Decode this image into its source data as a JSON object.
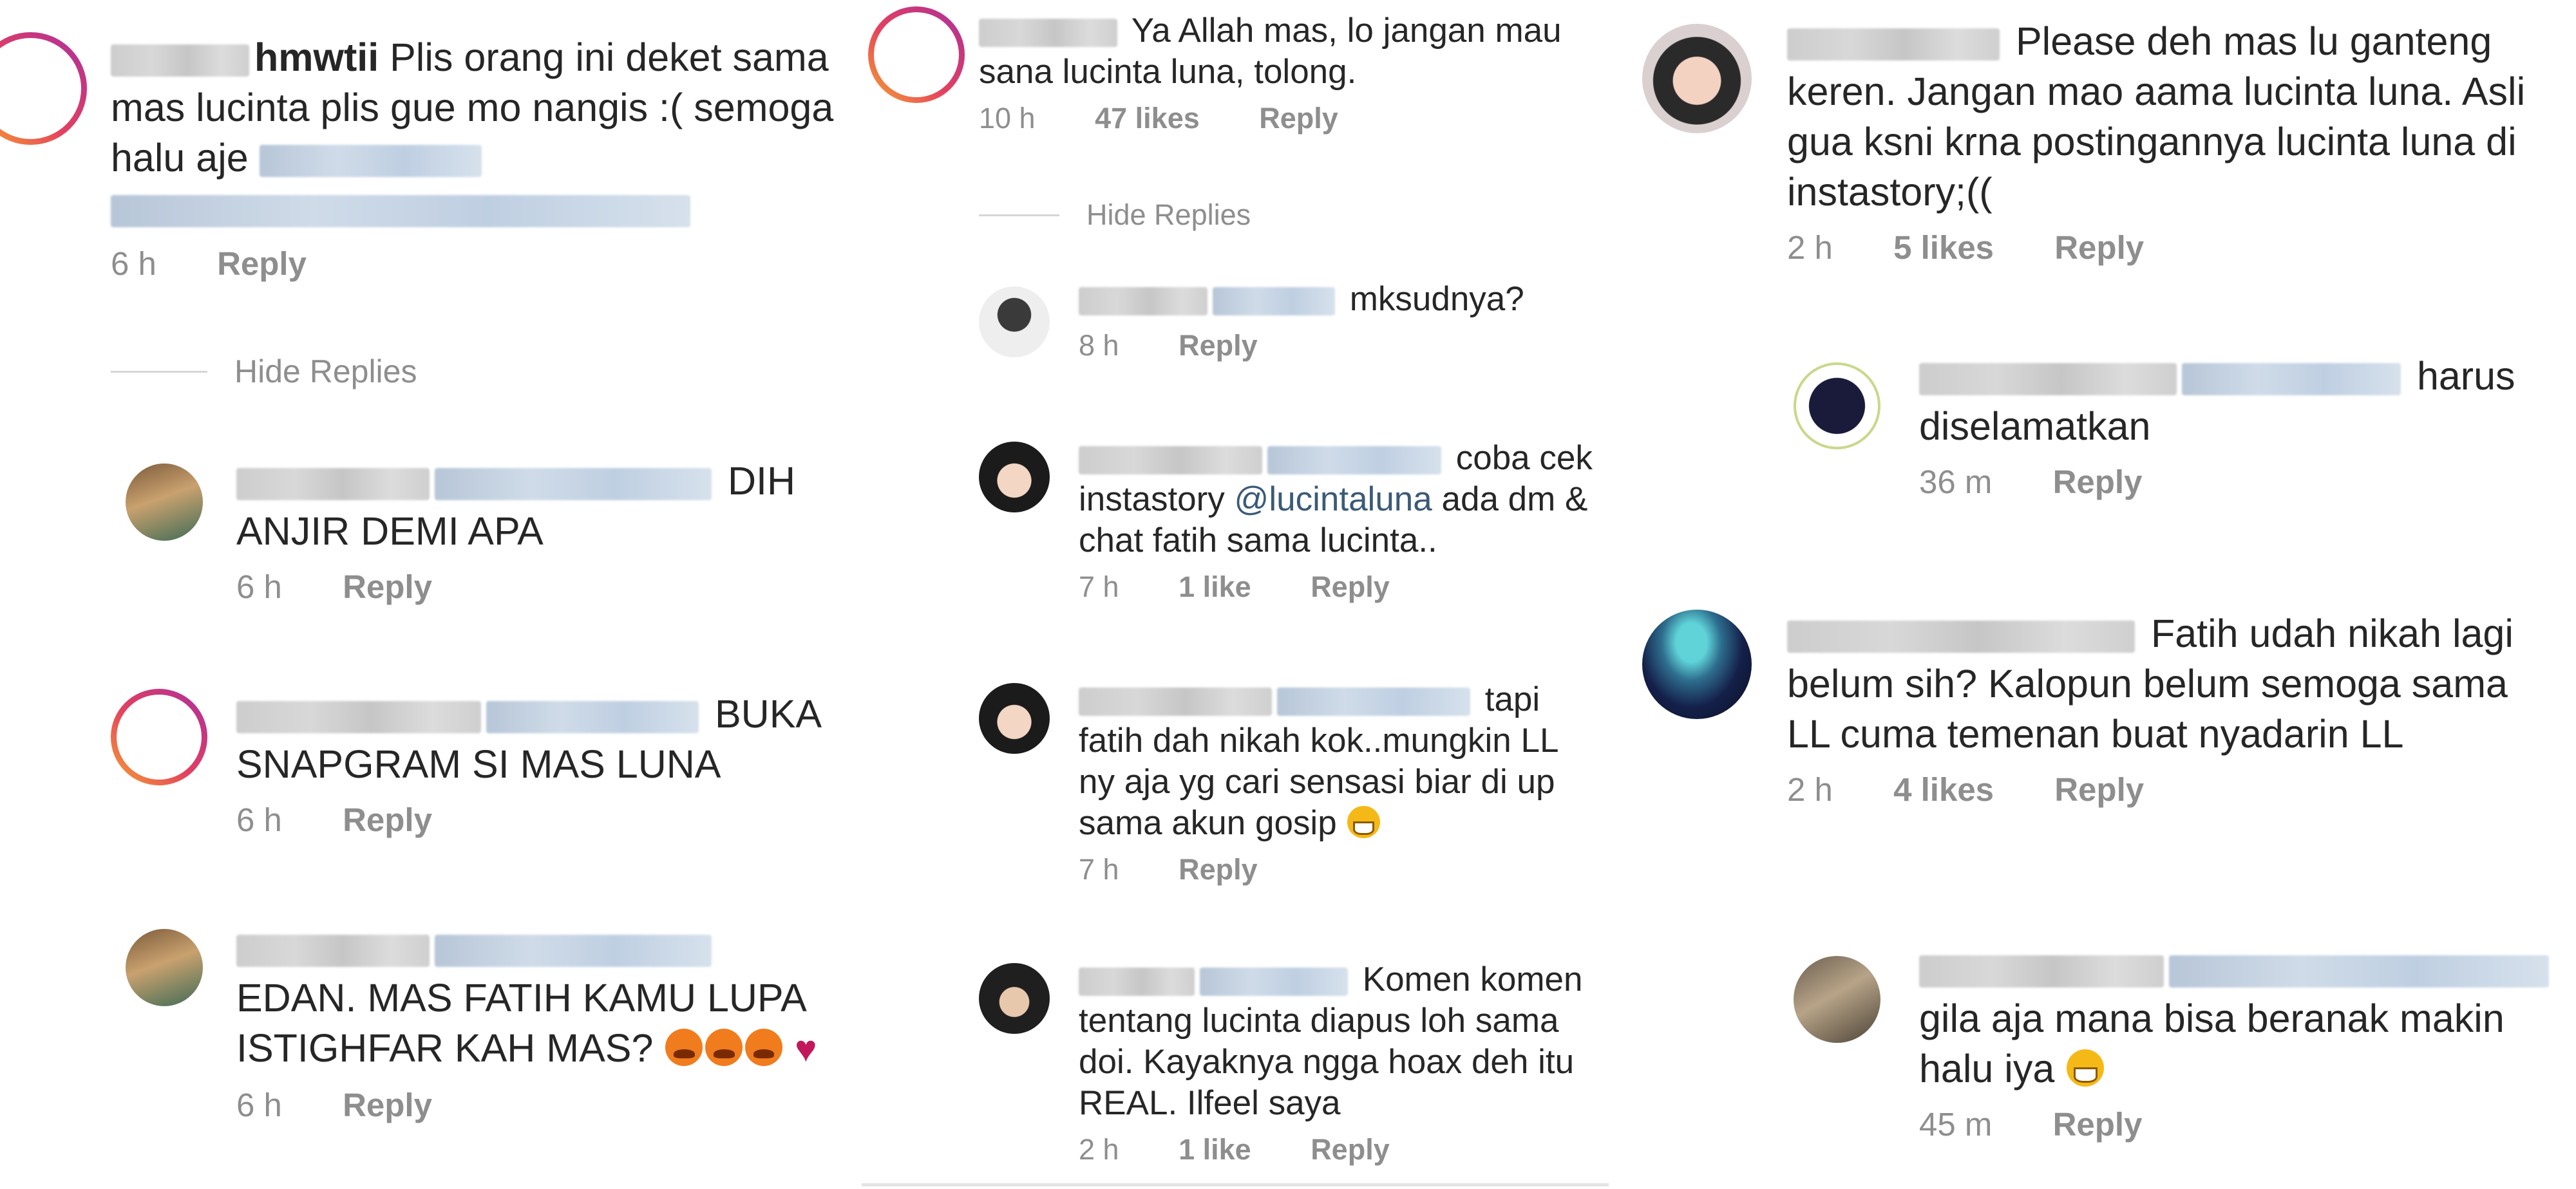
{
  "panel1": {
    "c1": {
      "username_visible": "hmwtii",
      "text": "Plis orang ini deket sama mas lucinta plis gue mo nangis :( semoga halu aje",
      "time": "6 h",
      "reply": "Reply"
    },
    "hide_replies": "Hide Replies",
    "r1": {
      "text": "DIH ANJIR DEMI APA",
      "time": "6 h",
      "reply": "Reply"
    },
    "r2": {
      "text": "BUKA SNAPGRAM SI MAS LUNA",
      "time": "6 h",
      "reply": "Reply"
    },
    "r3": {
      "text": "EDAN. MAS FATIH KAMU LUPA ISTIGHFAR KAH MAS?",
      "time": "6 h",
      "reply": "Reply"
    }
  },
  "panel2": {
    "c1": {
      "text": "Ya Allah mas, lo jangan mau sana lucinta luna, tolong.",
      "time": "10 h",
      "likes": "47 likes",
      "reply": "Reply"
    },
    "hide_replies": "Hide Replies",
    "r1": {
      "text": "mksudnya?",
      "time": "8 h",
      "reply": "Reply"
    },
    "r2": {
      "text_a": "coba cek instastory",
      "mention": "@lucintaluna",
      "text_b": "ada dm & chat fatih sama lucinta..",
      "time": "7 h",
      "likes": "1 like",
      "reply": "Reply"
    },
    "r3": {
      "text": "tapi fatih dah nikah kok..mungkin LL ny aja yg cari sensasi biar di up sama akun gosip",
      "time": "7 h",
      "reply": "Reply"
    },
    "r4": {
      "text": "Komen komen tentang lucinta diapus loh sama doi. Kayaknya ngga hoax deh itu REAL. Ilfeel saya",
      "time": "2 h",
      "likes": "1 like",
      "reply": "Reply"
    }
  },
  "panel3": {
    "c1": {
      "text": "Please deh mas lu ganteng keren. Jangan mao aama lucinta luna. Asli gua ksni krna postingannya lucinta luna di instastory;((",
      "time": "2 h",
      "likes": "5 likes",
      "reply": "Reply"
    },
    "r1": {
      "text": "harus diselamatkan",
      "time": "36 m",
      "reply": "Reply"
    },
    "c2": {
      "text": "Fatih udah nikah lagi belum sih? Kalopun belum semoga sama LL cuma temenan buat nyadarin LL",
      "time": "2 h",
      "likes": "4 likes",
      "reply": "Reply"
    },
    "r2": {
      "text": "gila aja mana bisa beranak makin halu iya",
      "time": "45 m",
      "reply": "Reply"
    }
  },
  "colors": {
    "text": "#262626",
    "meta": "#8e8e8e",
    "mention": "#3b5a78",
    "story_ring": "#e4405f"
  },
  "icons": [
    "avatar",
    "story-ring-avatar",
    "grinning-face-emoji",
    "angry-face-emoji",
    "broken-heart-emoji"
  ]
}
